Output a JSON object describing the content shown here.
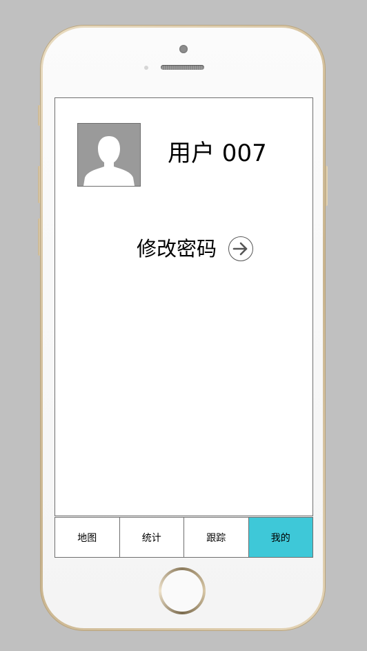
{
  "profile": {
    "username": "用户 007",
    "avatar_icon": "person-silhouette-icon"
  },
  "actions": {
    "change_password_label": "修改密码",
    "change_password_icon": "arrow-right-circle-icon"
  },
  "tabbar": {
    "active_color": "#3ec8d8",
    "tabs": [
      {
        "label": "地图",
        "active": false
      },
      {
        "label": "统计",
        "active": false
      },
      {
        "label": "跟踪",
        "active": false
      },
      {
        "label": "我的",
        "active": true
      }
    ]
  }
}
